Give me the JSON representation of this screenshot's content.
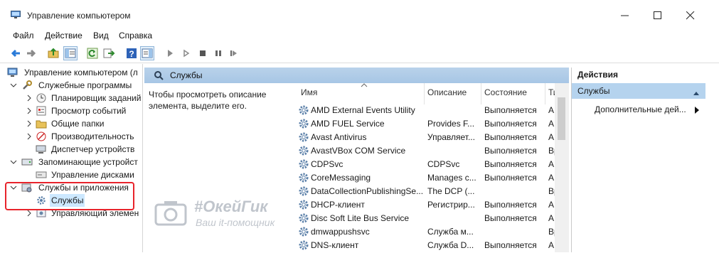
{
  "window": {
    "title": "Управление компьютером",
    "icon": "computer-management-icon"
  },
  "menu": [
    "Файл",
    "Действие",
    "Вид",
    "Справка"
  ],
  "tree": {
    "root": "Управление компьютером (л",
    "utilities": "Служебные программы",
    "task_scheduler": "Планировщик заданий",
    "event_viewer": "Просмотр событий",
    "shared_folders": "Общие папки",
    "performance": "Производительность",
    "device_manager": "Диспетчер устройств",
    "storage": "Запоминающие устройст",
    "disk_management": "Управление дисками",
    "services_apps": "Службы и приложения",
    "services": "Службы",
    "wmi": "Управляющий элемен"
  },
  "center": {
    "header": "Службы",
    "description": "Чтобы просмотреть описание элемента, выделите его.",
    "columns": [
      "Имя",
      "Описание",
      "Состояние",
      "Ти"
    ],
    "rows": [
      {
        "name": "AMD External Events Utility",
        "desc": "",
        "state": "Выполняется",
        "type": "А"
      },
      {
        "name": "AMD FUEL Service",
        "desc": "Provides F...",
        "state": "Выполняется",
        "type": "А"
      },
      {
        "name": "Avast Antivirus",
        "desc": "Управляет...",
        "state": "Выполняется",
        "type": "А"
      },
      {
        "name": "AvastVBox COM Service",
        "desc": "",
        "state": "Выполняется",
        "type": "Вр"
      },
      {
        "name": "CDPSvc",
        "desc": "CDPSvc",
        "state": "Выполняется",
        "type": "А"
      },
      {
        "name": "CoreMessaging",
        "desc": "Manages c...",
        "state": "Выполняется",
        "type": "А"
      },
      {
        "name": "DataCollectionPublishingSe...",
        "desc": "The DCP (...",
        "state": "",
        "type": "Вр"
      },
      {
        "name": "DHCP-клиент",
        "desc": "Регистрир...",
        "state": "Выполняется",
        "type": "А"
      },
      {
        "name": "Disc Soft Lite Bus Service",
        "desc": "",
        "state": "Выполняется",
        "type": "А"
      },
      {
        "name": "dmwappushsvc",
        "desc": "Служба м...",
        "state": "",
        "type": "Вр"
      },
      {
        "name": "DNS-клиент",
        "desc": "Служба D...",
        "state": "Выполняется",
        "type": "А"
      }
    ]
  },
  "actions": {
    "title": "Действия",
    "section": "Службы",
    "item": "Дополнительные дей..."
  },
  "watermark": {
    "title": "#ОкейГик",
    "subtitle": "Ваш it-помощник"
  },
  "colors": {
    "header_blue": "#b9d2ea",
    "selection": "#cce8ff",
    "highlight_red": "#e8242c"
  }
}
